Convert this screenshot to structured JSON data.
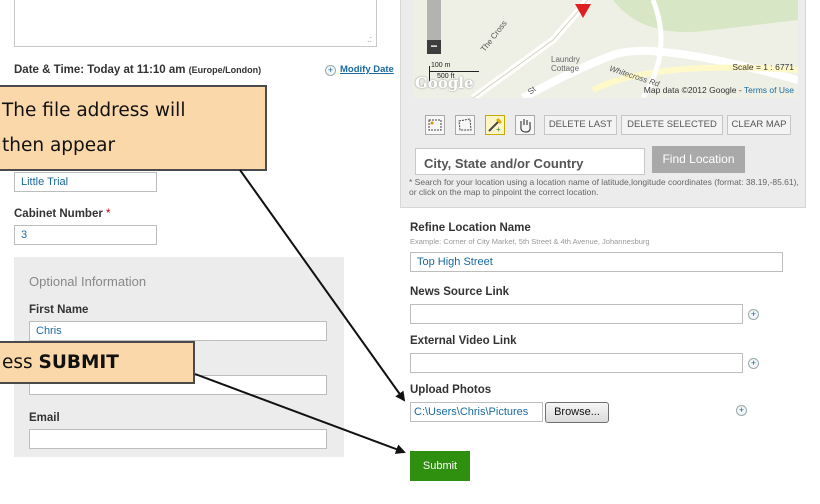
{
  "left_form": {
    "datetime_label": "Date & Time: Today at 11:10 am",
    "datetime_tz": "(Europe/London)",
    "modify_date": "Modify Date",
    "title_value": "Little Trial",
    "cabinet_label": "Cabinet Number",
    "required_mark": "*",
    "cabinet_value": "3",
    "optional_heading": "Optional Information",
    "first_name_label": "First Name",
    "first_name_value": "Chris",
    "email_label": "Email"
  },
  "map": {
    "scale_label": "100 m",
    "scale_sub": "500 ft",
    "street_cross": "The Cross",
    "street_laundry": "Laundry Cottage",
    "street_whitecross": "Whitecross Rd",
    "street_st": "St",
    "scale_ratio": "Scale = 1 : 6771",
    "attribution": "Map data ©2012 Google",
    "terms": "Terms of Use",
    "google_logo": "Google"
  },
  "map_tools": {
    "delete_last": "DELETE LAST",
    "delete_selected": "DELETE SELECTED",
    "clear_map": "CLEAR MAP"
  },
  "location": {
    "placeholder": "City, State and/or Country",
    "find_button": "Find Location",
    "help_text": "* Search for your location using a location name of latitude,longitude coordinates (format: 38.19,-85.61), or click on the map to pinpoint the correct location."
  },
  "right_form": {
    "refine_label": "Refine Location Name",
    "refine_example": "Example: Corner of City Market, 5th Street & 4th Avenue, Johannesburg",
    "refine_value": "Top High Street",
    "news_label": "News Source Link",
    "video_label": "External Video Link",
    "photos_label": "Upload Photos",
    "photo_path": "C:\\Users\\Chris\\Pictures",
    "browse_button": "Browse...",
    "submit_button": "Submit"
  },
  "callouts": {
    "file_address_line1": "The file address will",
    "file_address_line2": "then appear",
    "press_prefix": "ess ",
    "press_bold": "SUBMIT"
  },
  "colors": {
    "callout_fill": "#fad8a9",
    "submit_green": "#2f8f0f",
    "link_blue": "#1a6a9e"
  }
}
